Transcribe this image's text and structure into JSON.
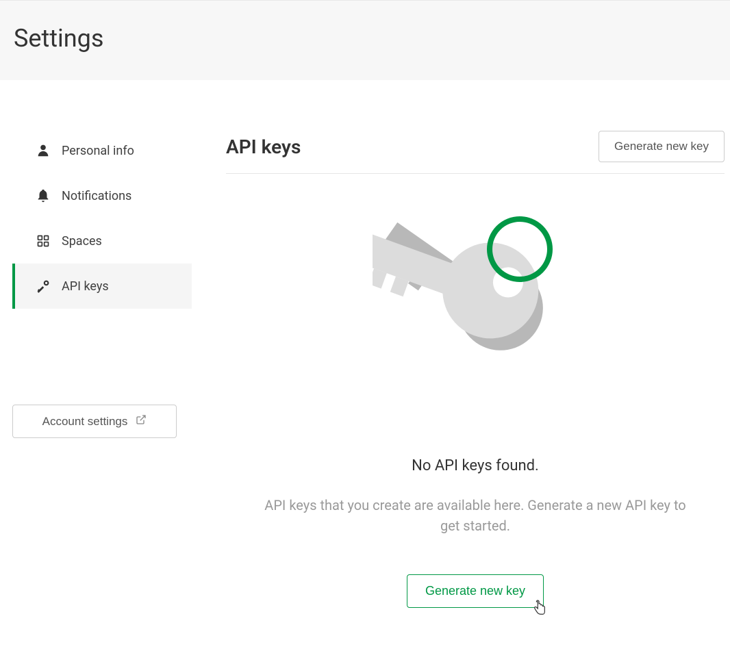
{
  "header": {
    "title": "Settings"
  },
  "sidebar": {
    "items": [
      {
        "label": "Personal info",
        "icon": "person-icon",
        "active": false
      },
      {
        "label": "Notifications",
        "icon": "bell-icon",
        "active": false
      },
      {
        "label": "Spaces",
        "icon": "grid-icon",
        "active": false
      },
      {
        "label": "API keys",
        "icon": "key-icon",
        "active": true
      }
    ],
    "account_button": "Account settings"
  },
  "main": {
    "title": "API keys",
    "generate_button": "Generate new key",
    "empty_title": "No API keys found.",
    "empty_description": "API keys that you create are available here. Generate a new API key to get started.",
    "generate_button_center": "Generate new key"
  }
}
